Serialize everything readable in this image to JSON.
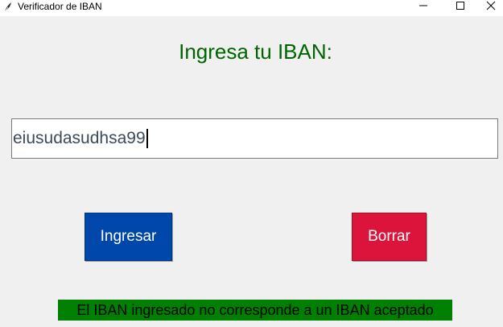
{
  "window": {
    "title": "Verificador de IBAN",
    "controls": {
      "minimize_icon": "minimize-icon",
      "maximize_icon": "maximize-icon",
      "close_icon": "close-icon"
    }
  },
  "main": {
    "prompt": "Ingresa tu IBAN:",
    "prompt_color": "#006400",
    "iban_input": {
      "value": "eiusudasudhsa99"
    },
    "buttons": {
      "ingresar_label": "Ingresar",
      "ingresar_color": "#0047ab",
      "borrar_label": "Borrar",
      "borrar_color": "#dc143c"
    },
    "status": {
      "message": "El IBAN ingresado no corresponde a un IBAN aceptado",
      "background": "#008000"
    }
  }
}
